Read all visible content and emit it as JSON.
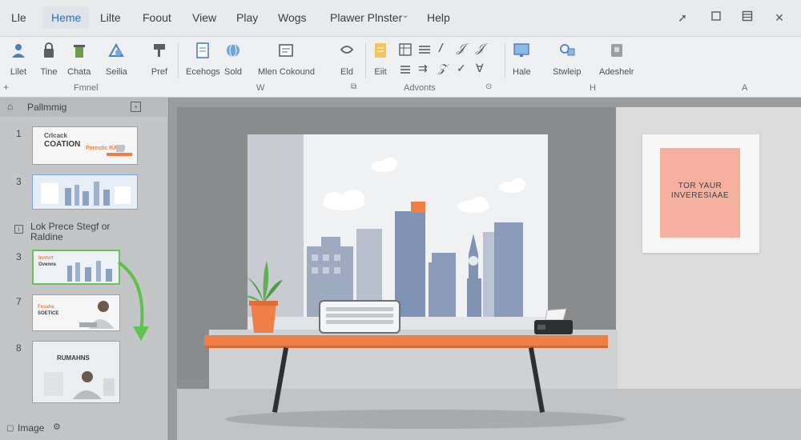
{
  "menu": {
    "items": [
      "Lle",
      "Heme",
      "Lilte",
      "Foout",
      "View",
      "Play",
      "Wogs",
      "Plawer Plnster",
      "Help"
    ],
    "active_index": 1
  },
  "ribbon": {
    "buttons": [
      {
        "label": "Lilet",
        "icon": "user-icon"
      },
      {
        "label": "Tine",
        "icon": "lock-icon"
      },
      {
        "label": "Chata",
        "icon": "trash-icon"
      },
      {
        "label": "Seilia",
        "icon": "shape-icon"
      },
      {
        "label": "Pref",
        "icon": "format-painter-icon"
      },
      {
        "label": "Ecehogs",
        "icon": "document-icon"
      },
      {
        "label": "Sold",
        "icon": "globe-icon"
      },
      {
        "label": "Mlen Cokound",
        "icon": "text-box-icon"
      },
      {
        "label": "Eld",
        "icon": "shape-outline-icon"
      },
      {
        "label": "Eiit",
        "icon": "edit-document-icon"
      },
      {
        "label": "Hale",
        "icon": "monitor-icon"
      },
      {
        "label": "Stwleip",
        "icon": "search-folder-icon"
      },
      {
        "label": "Adeshelr",
        "icon": "add-in-icon"
      }
    ],
    "groups": [
      "Fmnel",
      "W",
      "Advonts",
      "H",
      "A"
    ]
  },
  "left_panel": {
    "title": "Pallmmig",
    "section_title": "Lok Prece Stegf or Raldine",
    "slides": [
      {
        "number": "1",
        "line1": "Crlcack",
        "line2": "COATION",
        "line3": "Perestic RAAR"
      },
      {
        "number": "3",
        "line1": "",
        "line2": "",
        "line3": ""
      },
      {
        "number": "3",
        "line1": "Inntvrt",
        "line2": "Ovenns",
        "line3": ""
      },
      {
        "number": "7",
        "line1": "Fesahe",
        "line2": "SOETICE",
        "line3": ""
      },
      {
        "number": "8",
        "line1": "RUMAHNS",
        "line2": "",
        "line3": ""
      }
    ],
    "status_label": "Image"
  },
  "canvas": {
    "poster_text": "TOR YAUR INVERESIAAE"
  },
  "colors": {
    "accent": "#2f6cb3",
    "desk": "#f07f45",
    "poster": "#f6b0a0",
    "selected_slide": "#67c45b"
  }
}
